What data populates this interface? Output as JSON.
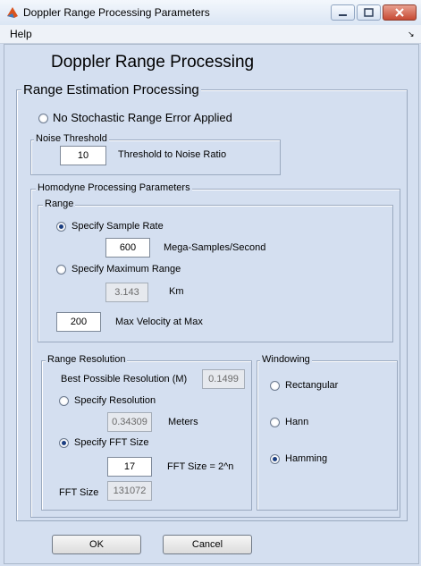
{
  "window": {
    "title": "Doppler Range Processing Parameters"
  },
  "menu": {
    "help": "Help"
  },
  "main_title": "Doppler Range Processing",
  "range_estimation": {
    "legend": "Range Estimation Processing",
    "no_error_option": "No Stochastic Range Error Applied"
  },
  "noise_threshold": {
    "legend": "Noise Threshold",
    "value": "10",
    "label": "Threshold to Noise Ratio"
  },
  "homodyne": {
    "legend": "Homodyne Processing Parameters",
    "range": {
      "legend": "Range",
      "sample_rate_option": "Specify Sample Rate",
      "sample_rate_value": "600",
      "sample_rate_unit": "Mega-Samples/Second",
      "max_range_option": "Specify Maximum Range",
      "max_range_value": "3.143",
      "max_range_unit": "Km",
      "velocity_value": "200",
      "velocity_label": "Max Velocity at Max"
    },
    "resolution": {
      "legend": "Range Resolution",
      "best_label": "Best Possible Resolution (M)",
      "best_value": "0.1499",
      "specify_resolution_option": "Specify Resolution",
      "resolution_value": "0.34309",
      "resolution_unit": "Meters",
      "fft_option": "Specify FFT Size",
      "fft_exponent_value": "17",
      "fft_exponent_label": "FFT Size = 2^n",
      "fft_size_label": "FFT Size",
      "fft_size_value": "131072"
    },
    "windowing": {
      "legend": "Windowing",
      "options": [
        "Rectangular",
        "Hann",
        "Hamming"
      ],
      "selected": "Hamming"
    }
  },
  "buttons": {
    "ok": "OK",
    "cancel": "Cancel"
  }
}
